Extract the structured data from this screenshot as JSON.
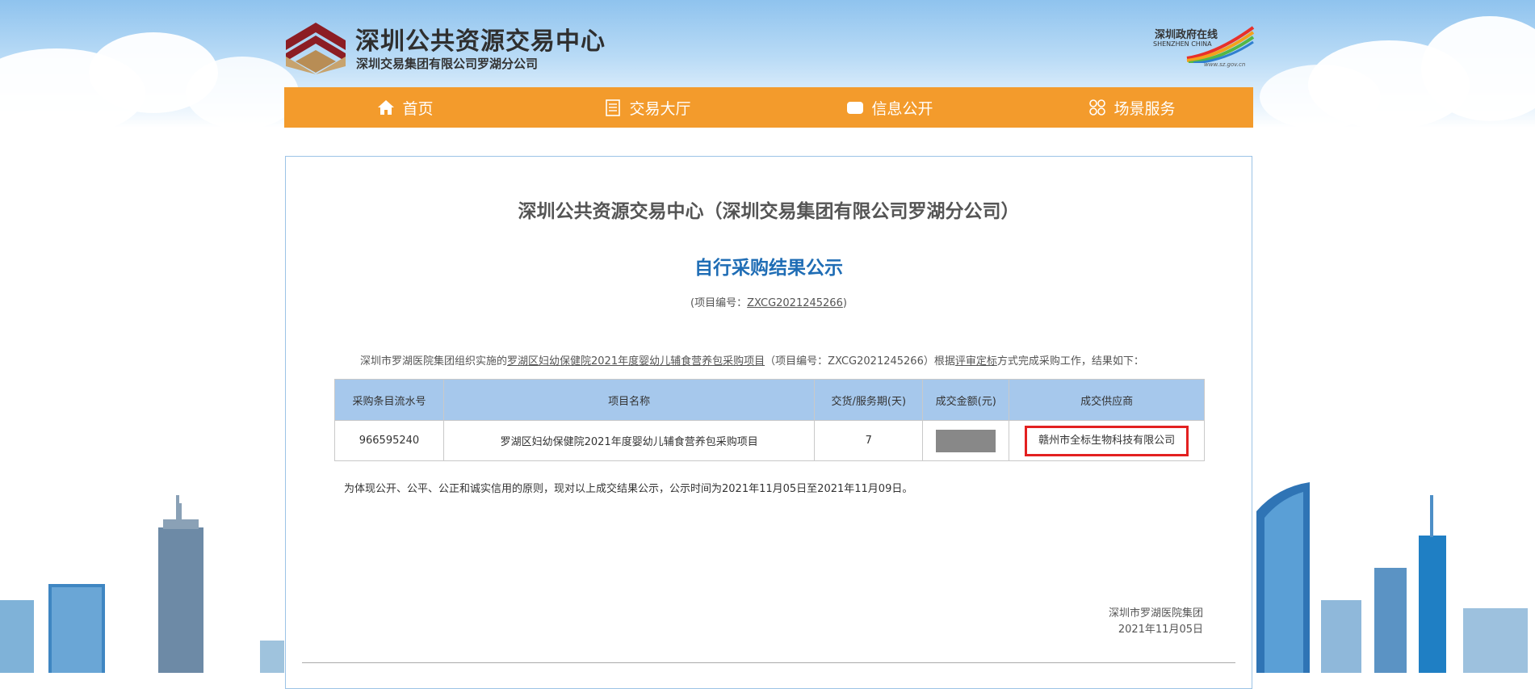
{
  "header": {
    "site_title": "深圳公共资源交易中心",
    "site_subtitle": "深圳交易集团有限公司罗湖分公司",
    "gov_logo_text": "深圳政府在线",
    "gov_logo_en": "SHENZHEN  CHINA",
    "gov_logo_url_text": "www.sz.gov.cn"
  },
  "nav": [
    {
      "label": "首页",
      "icon": "home-icon"
    },
    {
      "label": "交易大厅",
      "icon": "list-icon"
    },
    {
      "label": "信息公开",
      "icon": "message-icon"
    },
    {
      "label": "场景服务",
      "icon": "grid-icon"
    }
  ],
  "notice": {
    "org_title": "深圳公共资源交易中心（深圳交易集团有限公司罗湖分公司）",
    "title": "自行采购结果公示",
    "project_no_prefix": "(项目编号：",
    "project_no": "ZXCG2021245266",
    "project_no_suffix": ")",
    "intro_prefix": "深圳市罗湖医院集团组织实施的",
    "intro_project": "罗湖区妇幼保健院2021年度婴幼儿辅食营养包采购项目",
    "intro_middle": "（项目编号：ZXCG2021245266）根据",
    "intro_method": "评审定标",
    "intro_suffix": "方式完成采购工作，结果如下：",
    "table": {
      "headers": [
        "采购条目流水号",
        "项目名称",
        "交货/服务期(天)",
        "成交金额(元)",
        "成交供应商"
      ],
      "rows": [
        {
          "serial": "966595240",
          "name": "罗湖区妇幼保健院2021年度婴幼儿辅食营养包采购项目",
          "period": "7",
          "amount": "",
          "supplier": "赣州市全标生物科技有限公司"
        }
      ]
    },
    "statement": "为体现公开、公平、公正和诚实信用的原则，现对以上成交结果公示，公示时间为2021年11月05日至2021年11月09日。",
    "sign_org": "深圳市罗湖医院集团",
    "sign_date": "2021年11月05日"
  },
  "colors": {
    "nav_bg": "#f39b2c",
    "title_blue": "#1f6db5",
    "table_header_bg": "#a6c8ec",
    "highlight_red": "#e32020"
  }
}
